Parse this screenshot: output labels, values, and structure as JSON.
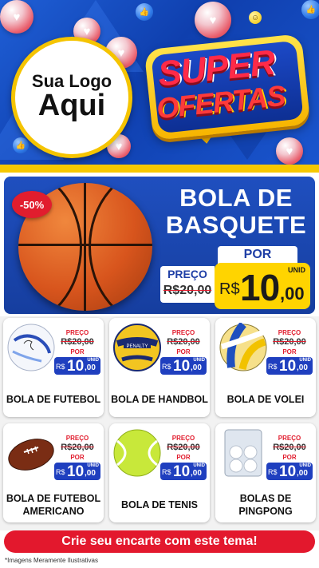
{
  "header": {
    "logo_line1": "Sua Logo",
    "logo_line2": "Aqui",
    "badge_line1": "SUPER",
    "badge_line2": "OFERTAS"
  },
  "hero": {
    "discount": "-50%",
    "title_line1": "BOLA DE",
    "title_line2": "BASQUETE",
    "preco_label": "PREÇO",
    "old_price": "R$20,00",
    "por_label": "POR",
    "currency": "R$",
    "price_int": "10",
    "price_cents": ",00",
    "unit": "UNID"
  },
  "products": [
    {
      "name": "BOLA DE FUTEBOL",
      "preco_label": "PREÇO",
      "old_price": "R$20,00",
      "por_label": "POR",
      "currency": "R$",
      "price_int": "10",
      "price_cents": ",00",
      "unit": "UNID",
      "icon": "soccer-ball-icon"
    },
    {
      "name": "BOLA DE HANDBOL",
      "preco_label": "PREÇO",
      "old_price": "R$20,00",
      "por_label": "POR",
      "currency": "R$",
      "price_int": "10",
      "price_cents": ",00",
      "unit": "UNID",
      "icon": "handball-icon"
    },
    {
      "name": "BOLA DE VOLEI",
      "preco_label": "PREÇO",
      "old_price": "R$20,00",
      "por_label": "POR",
      "currency": "R$",
      "price_int": "10",
      "price_cents": ",00",
      "unit": "UNID",
      "icon": "volleyball-icon"
    },
    {
      "name": "BOLA DE FUTEBOL AMERICANO",
      "preco_label": "PREÇO",
      "old_price": "R$20,00",
      "por_label": "POR",
      "currency": "R$",
      "price_int": "10",
      "price_cents": ",00",
      "unit": "UNID",
      "icon": "football-icon"
    },
    {
      "name": "BOLA DE TENIS",
      "preco_label": "PREÇO",
      "old_price": "R$20,00",
      "por_label": "POR",
      "currency": "R$",
      "price_int": "10",
      "price_cents": ",00",
      "unit": "UNID",
      "icon": "tennis-ball-icon"
    },
    {
      "name": "BOLAS DE PINGPONG",
      "preco_label": "PREÇO",
      "old_price": "R$20,00",
      "por_label": "POR",
      "currency": "R$",
      "price_int": "10",
      "price_cents": ",00",
      "unit": "UNID",
      "icon": "pingpong-balls-icon"
    }
  ],
  "footer": {
    "cta": "Crie seu encarte com este tema!",
    "disclaimer": "*Imagens Meramente Ilustrativas"
  },
  "colors": {
    "primary_blue": "#1f4fbf",
    "accent_yellow": "#ffd400",
    "accent_red": "#e3182d"
  }
}
